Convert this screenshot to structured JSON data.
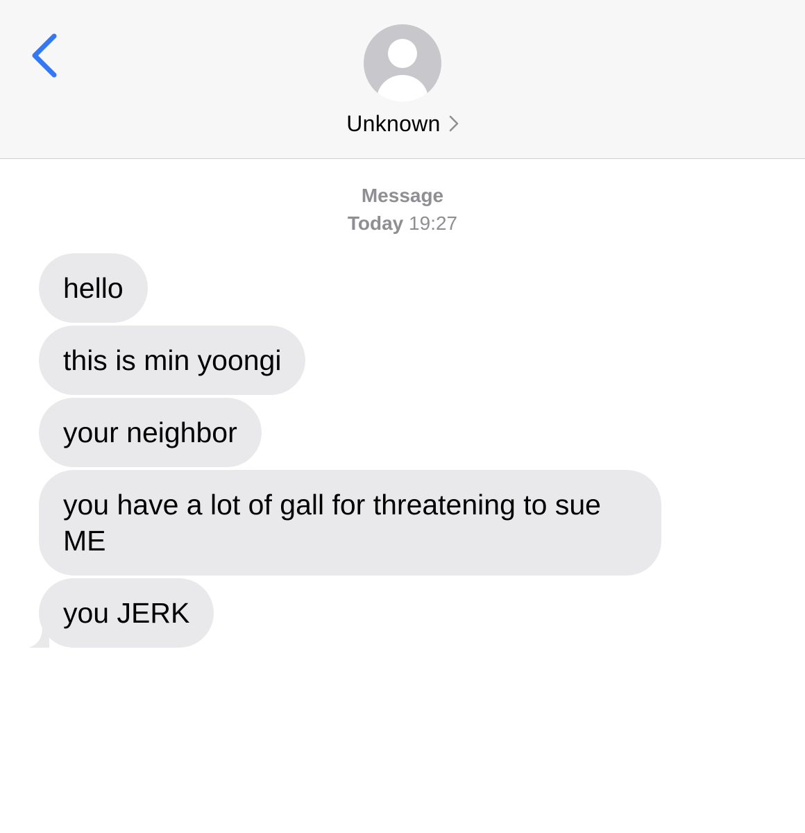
{
  "header": {
    "contact_name": "Unknown",
    "accent_color": "#3478f6",
    "back_icon": "chevron-left-icon",
    "avatar_icon": "person-placeholder-icon",
    "name_chevron_icon": "chevron-right-icon"
  },
  "thread_meta": {
    "service": "Message",
    "day": "Today",
    "time": "19:27"
  },
  "messages": [
    {
      "text": "hello",
      "direction": "incoming"
    },
    {
      "text": "this is min yoongi",
      "direction": "incoming"
    },
    {
      "text": "your neighbor",
      "direction": "incoming"
    },
    {
      "text": "you have a lot of gall for threatening to sue ME",
      "direction": "incoming"
    },
    {
      "text": "you JERK",
      "direction": "incoming"
    }
  ],
  "colors": {
    "incoming_bubble": "#e9e9eb",
    "meta_text": "#8e8e93",
    "header_bg": "#f7f7f7"
  }
}
